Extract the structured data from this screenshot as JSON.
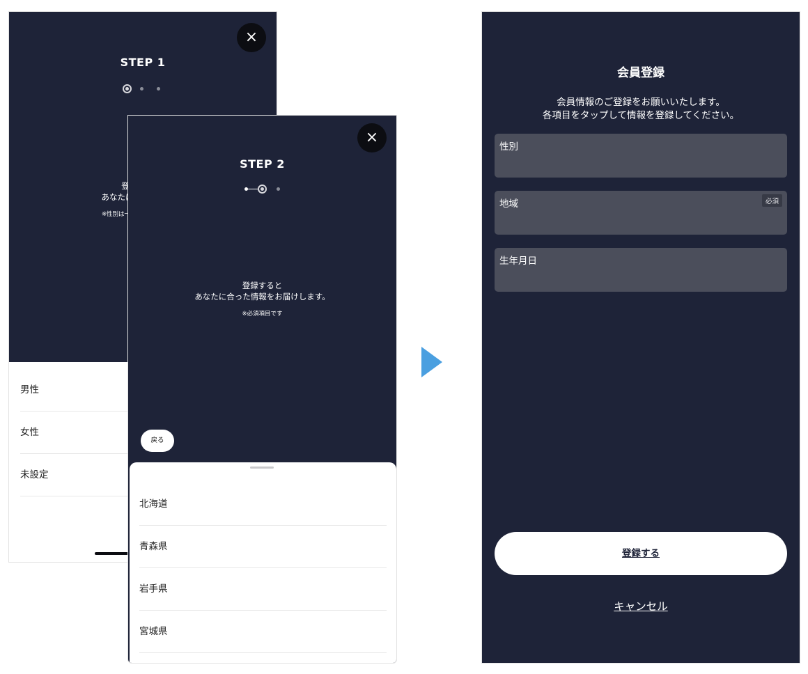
{
  "step1": {
    "close_icon": "×",
    "step_title": "STEP 1",
    "info_line1": "登",
    "info_line2": "あなたに合っ",
    "note": "※性別は一度登",
    "options": [
      "男性",
      "女性",
      "未設定"
    ]
  },
  "step2": {
    "close_icon": "×",
    "step_title": "STEP 2",
    "info_line1": "登録すると",
    "info_line2": "あなたに合った情報をお届けします。",
    "note": "※必須項目です",
    "back_label": "戻る",
    "prefectures": [
      "北海道",
      "青森県",
      "岩手県",
      "宮城県"
    ]
  },
  "registration": {
    "title": "会員登録",
    "desc_line1": "会員情報のご登録をお願いいたします。",
    "desc_line2": "各項目をタップして情報を登録してください。",
    "fields": [
      {
        "label": "性別"
      },
      {
        "label": "地域",
        "badge": "必須"
      },
      {
        "label": "生年月日"
      }
    ],
    "submit_label": "登録する",
    "cancel_label": "キャンセル"
  },
  "colors": {
    "navy_background": "#1e2338",
    "field_background": "#4b4e5b",
    "arrow": "#4a9fe0"
  },
  "icons": {
    "close": "close-icon",
    "arrow": "arrow-right-icon"
  }
}
